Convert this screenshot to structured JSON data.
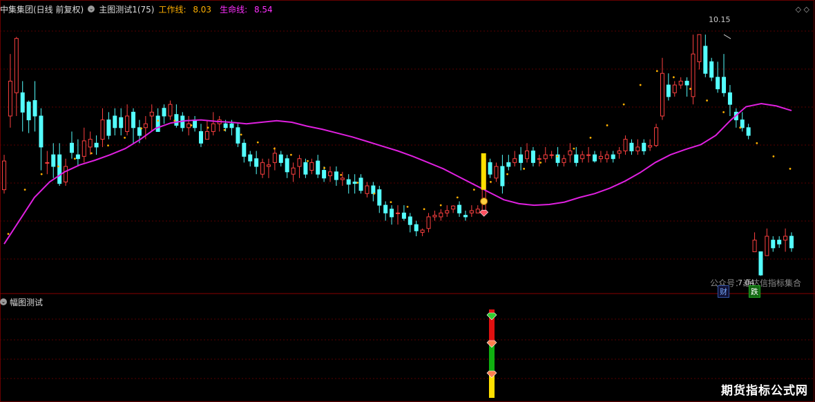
{
  "header": {
    "title": "中集集团(日线 前复权)",
    "indicator": "主图测试1(75)",
    "line1_label": "工作线:",
    "line1_value": "8.03",
    "line2_label": "生命线:",
    "line2_value": "8.54",
    "corner_icons": "◇ ◇"
  },
  "sub_panel": {
    "title": "幅图测试"
  },
  "annotations": {
    "high": "10.15",
    "low": "7.04",
    "watermark": "公众号：通达信指标集合",
    "tag_cai": "财",
    "tag_die": "跌",
    "signal_marker": "S"
  },
  "brand": "期货指标公式网",
  "colors": {
    "up": "#ff4040",
    "down": "#54ffff",
    "life": "#e020e0",
    "work": "#ffb000"
  },
  "chart_data": {
    "type": "candlestick",
    "ylim": [
      6.9,
      10.4
    ],
    "candles": [
      [
        8.15,
        8.52,
        8.6,
        8.1
      ],
      [
        9.1,
        9.55,
        9.9,
        8.95
      ],
      [
        9.4,
        10.1,
        10.12,
        9.1
      ],
      [
        9.4,
        9.15,
        9.55,
        8.9
      ],
      [
        9.28,
        9.05,
        9.3,
        8.88
      ],
      [
        9.3,
        9.1,
        9.55,
        8.9
      ],
      [
        9.1,
        8.7,
        9.2,
        8.4
      ],
      [
        8.5,
        8.5,
        8.65,
        8.35
      ],
      [
        8.6,
        8.45,
        8.75,
        8.3
      ],
      [
        8.6,
        8.23,
        8.75,
        8.2
      ],
      [
        8.25,
        8.45,
        8.55,
        8.2
      ],
      [
        8.75,
        8.63,
        8.9,
        8.55
      ],
      [
        8.6,
        8.55,
        8.8,
        8.45
      ],
      [
        8.58,
        8.78,
        8.95,
        8.5
      ],
      [
        8.7,
        8.8,
        8.9,
        8.6
      ],
      [
        8.75,
        8.7,
        8.85,
        8.6
      ],
      [
        8.8,
        9.05,
        9.2,
        8.7
      ],
      [
        9.05,
        8.85,
        9.15,
        8.8
      ],
      [
        9.1,
        8.95,
        9.2,
        8.85
      ],
      [
        9.08,
        8.95,
        9.2,
        8.85
      ],
      [
        8.9,
        9.1,
        9.25,
        8.85
      ],
      [
        9.15,
        8.95,
        9.2,
        8.75
      ],
      [
        8.95,
        8.85,
        9.05,
        8.75
      ],
      [
        8.95,
        9.0,
        9.1,
        8.8
      ],
      [
        9.1,
        9.15,
        9.25,
        8.9
      ],
      [
        9.1,
        8.9,
        9.2,
        8.9
      ],
      [
        9.2,
        9.1,
        9.25,
        9.0
      ],
      [
        9.1,
        9.25,
        9.3,
        9.05
      ],
      [
        9.12,
        8.98,
        9.25,
        8.95
      ],
      [
        9.1,
        8.95,
        9.15,
        8.9
      ],
      [
        8.95,
        9.0,
        9.1,
        8.85
      ],
      [
        9.05,
        8.95,
        9.1,
        8.9
      ],
      [
        8.9,
        8.75,
        9.0,
        8.7
      ],
      [
        8.8,
        8.9,
        9.05,
        8.8
      ],
      [
        8.9,
        9.0,
        9.15,
        8.85
      ],
      [
        9.0,
        9.05,
        9.1,
        8.9
      ],
      [
        9.0,
        8.95,
        9.05,
        8.9
      ],
      [
        9.0,
        8.95,
        9.05,
        8.85
      ],
      [
        8.95,
        8.75,
        9.0,
        8.7
      ],
      [
        8.75,
        8.58,
        8.8,
        8.5
      ],
      [
        8.6,
        8.52,
        8.65,
        8.45
      ],
      [
        8.55,
        8.45,
        8.65,
        8.35
      ],
      [
        8.35,
        8.5,
        8.55,
        8.3
      ],
      [
        8.45,
        8.47,
        8.55,
        8.3
      ],
      [
        8.5,
        8.62,
        8.7,
        8.4
      ],
      [
        8.6,
        8.5,
        8.65,
        8.45
      ],
      [
        8.55,
        8.38,
        8.6,
        8.3
      ],
      [
        8.35,
        8.43,
        8.5,
        8.25
      ],
      [
        8.45,
        8.55,
        8.6,
        8.3
      ],
      [
        8.5,
        8.35,
        8.55,
        8.3
      ],
      [
        8.4,
        8.5,
        8.55,
        8.35
      ],
      [
        8.52,
        8.35,
        8.6,
        8.3
      ],
      [
        8.4,
        8.3,
        8.45,
        8.25
      ],
      [
        8.33,
        8.38,
        8.45,
        8.25
      ],
      [
        8.38,
        8.28,
        8.45,
        8.2
      ],
      [
        8.28,
        8.3,
        8.38,
        8.2
      ],
      [
        8.28,
        8.22,
        8.35,
        8.1
      ],
      [
        8.25,
        8.23,
        8.35,
        8.1
      ],
      [
        8.3,
        8.14,
        8.35,
        8.1
      ],
      [
        8.1,
        8.2,
        8.25,
        8.05
      ],
      [
        8.2,
        8.1,
        8.25,
        8.0
      ],
      [
        8.15,
        7.95,
        8.2,
        7.85
      ],
      [
        7.95,
        7.85,
        8.0,
        7.75
      ],
      [
        7.9,
        7.8,
        7.95,
        7.7
      ],
      [
        7.85,
        7.85,
        7.95,
        7.7
      ],
      [
        7.85,
        7.78,
        7.95,
        7.75
      ],
      [
        7.8,
        7.7,
        7.85,
        7.6
      ],
      [
        7.7,
        7.62,
        7.75,
        7.55
      ],
      [
        7.6,
        7.63,
        7.65,
        7.55
      ],
      [
        7.65,
        7.8,
        7.85,
        7.6
      ],
      [
        7.8,
        7.82,
        7.88,
        7.75
      ],
      [
        7.8,
        7.85,
        7.9,
        7.75
      ],
      [
        7.85,
        7.88,
        7.95,
        7.8
      ],
      [
        7.9,
        7.94,
        7.95,
        7.85
      ],
      [
        7.95,
        7.85,
        8.0,
        7.8
      ],
      [
        7.82,
        7.8,
        7.88,
        7.75
      ],
      [
        7.85,
        7.88,
        7.95,
        7.8
      ],
      [
        7.85,
        7.9,
        7.95,
        7.85
      ],
      [
        7.85,
        8.55,
        8.6,
        7.85
      ],
      [
        8.5,
        8.35,
        8.55,
        8.3
      ],
      [
        8.3,
        8.45,
        8.5,
        8.25
      ],
      [
        8.45,
        8.2,
        8.6,
        8.1
      ],
      [
        8.5,
        8.45,
        8.6,
        8.4
      ],
      [
        8.5,
        8.55,
        8.65,
        8.45
      ],
      [
        8.6,
        8.5,
        8.7,
        8.4
      ],
      [
        8.55,
        8.65,
        8.75,
        8.5
      ],
      [
        8.65,
        8.5,
        8.7,
        8.45
      ],
      [
        8.55,
        8.55,
        8.6,
        8.45
      ],
      [
        8.55,
        8.6,
        8.7,
        8.5
      ],
      [
        8.6,
        8.6,
        8.65,
        8.55
      ],
      [
        8.6,
        8.5,
        8.7,
        8.45
      ],
      [
        8.5,
        8.55,
        8.6,
        8.45
      ],
      [
        8.6,
        8.65,
        8.75,
        8.5
      ],
      [
        8.6,
        8.5,
        8.7,
        8.45
      ],
      [
        8.55,
        8.6,
        8.65,
        8.5
      ],
      [
        8.6,
        8.6,
        8.7,
        8.5
      ],
      [
        8.6,
        8.52,
        8.65,
        8.5
      ],
      [
        8.55,
        8.58,
        8.65,
        8.5
      ],
      [
        8.55,
        8.6,
        8.65,
        8.5
      ],
      [
        8.6,
        8.55,
        8.65,
        8.5
      ],
      [
        8.62,
        8.65,
        8.7,
        8.55
      ],
      [
        8.65,
        8.8,
        8.85,
        8.6
      ],
      [
        8.75,
        8.65,
        8.8,
        8.6
      ],
      [
        8.65,
        8.7,
        8.8,
        8.6
      ],
      [
        8.75,
        8.65,
        8.8,
        8.6
      ],
      [
        8.7,
        8.72,
        8.8,
        8.65
      ],
      [
        8.72,
        8.95,
        9.0,
        8.7
      ],
      [
        9.1,
        9.65,
        9.85,
        9.05
      ],
      [
        9.5,
        9.35,
        9.65,
        9.3
      ],
      [
        9.4,
        9.5,
        9.55,
        9.35
      ],
      [
        9.5,
        9.55,
        9.6,
        9.45
      ],
      [
        9.55,
        9.5,
        9.6,
        9.35
      ],
      [
        9.35,
        9.9,
        10.15,
        9.25
      ],
      [
        9.8,
        10.15,
        10.15,
        9.7
      ],
      [
        10.0,
        9.65,
        10.15,
        9.6
      ],
      [
        9.8,
        9.6,
        9.85,
        9.55
      ],
      [
        9.6,
        9.45,
        9.8,
        9.4
      ],
      [
        9.6,
        9.4,
        9.9,
        9.35
      ],
      [
        9.4,
        9.25,
        9.5,
        9.1
      ],
      [
        9.15,
        9.05,
        9.2,
        8.95
      ],
      [
        9.05,
        8.95,
        9.15,
        8.9
      ],
      [
        8.95,
        8.85,
        9.0,
        8.8
      ],
      [
        7.35,
        7.5,
        7.6,
        7.35
      ],
      [
        7.35,
        7.05,
        7.35,
        7.04
      ],
      [
        7.3,
        7.55,
        7.65,
        7.3
      ],
      [
        7.5,
        7.4,
        7.55,
        7.35
      ],
      [
        7.5,
        7.45,
        7.55,
        7.4
      ],
      [
        7.5,
        7.55,
        7.65,
        7.35
      ],
      [
        7.55,
        7.4,
        7.6,
        7.35
      ]
    ],
    "life_line": [
      7.45,
      7.75,
      8.05,
      8.25,
      8.38,
      8.47,
      8.53,
      8.6,
      8.68,
      8.8,
      8.94,
      9.01,
      9.04,
      9.05,
      9.03,
      9.02,
      9.0,
      9.02,
      9.04,
      9.02,
      8.97,
      8.93,
      8.88,
      8.83,
      8.77,
      8.71,
      8.65,
      8.58,
      8.5,
      8.42,
      8.32,
      8.22,
      8.12,
      8.02,
      7.97,
      7.95,
      7.96,
      7.99,
      8.05,
      8.1,
      8.17,
      8.26,
      8.37,
      8.5,
      8.6,
      8.67,
      8.73,
      8.85,
      9.05,
      9.22,
      9.26,
      9.23,
      9.17
    ],
    "work_dots": [
      7.58,
      8.15,
      8.35,
      8.45,
      8.55,
      8.62,
      8.72,
      8.82,
      8.94,
      9.04,
      9.04,
      8.98,
      8.95,
      8.92,
      8.86,
      8.76,
      8.68,
      8.6,
      8.52,
      8.43,
      8.34,
      8.24,
      8.1,
      7.99,
      7.93,
      7.9,
      7.95,
      8.05,
      8.15,
      8.25,
      8.35,
      8.42,
      8.5,
      8.58,
      8.68,
      8.82,
      8.98,
      9.25,
      9.5,
      9.68,
      9.6,
      9.45,
      9.3,
      9.15,
      8.95,
      8.75,
      8.58,
      8.42
    ],
    "signal_index": 78
  }
}
